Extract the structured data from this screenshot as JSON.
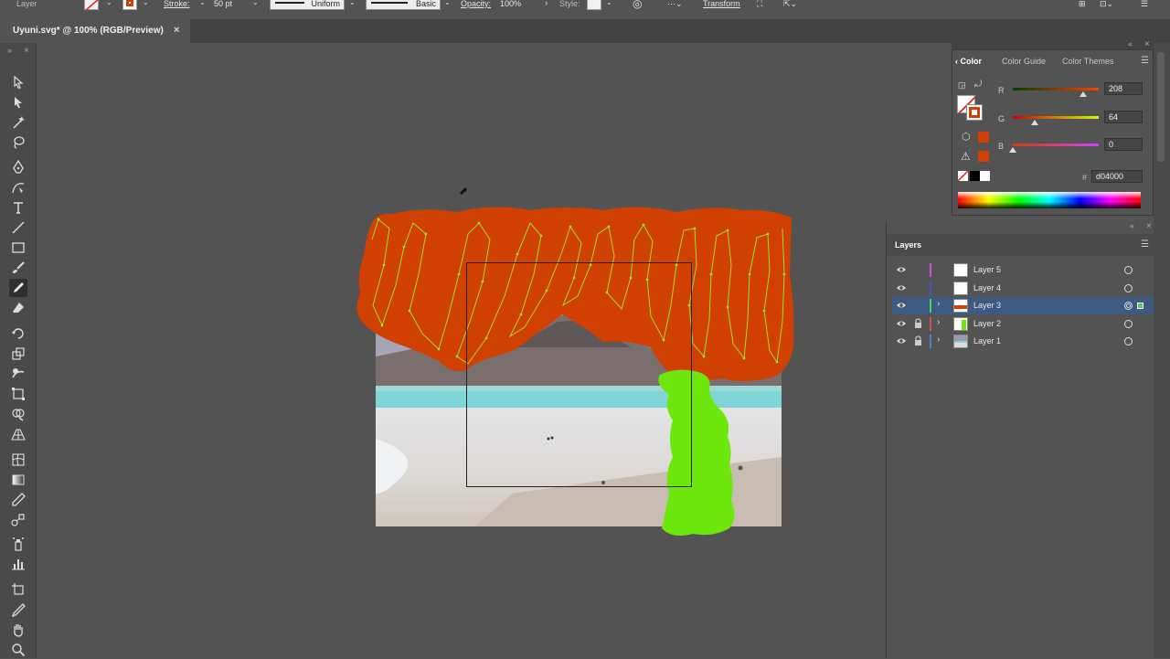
{
  "control_bar": {
    "layer_label": "Layer",
    "stroke_label": "Stroke:",
    "stroke_weight": "50 pt",
    "variable_width": "Uniform",
    "brush": "Basic",
    "opacity_label": "Opacity:",
    "opacity_value": "100%",
    "style_label": "Style:",
    "transform_label": "Transform"
  },
  "document": {
    "tab_title": "Uyuni.svg* @ 100% (RGB/Preview)",
    "close_glyph": "×"
  },
  "tools": [
    "selection-tool",
    "direct-selection-tool",
    "magic-wand-tool",
    "lasso-tool",
    "pen-tool",
    "curvature-tool",
    "type-tool",
    "line-tool",
    "rectangle-tool",
    "paintbrush-tool",
    "pencil-tool",
    "eraser-tool",
    "rotate-tool",
    "scale-tool",
    "warp-tool",
    "free-transform-tool",
    "shape-builder-tool",
    "perspective-grid-tool",
    "mesh-tool",
    "gradient-tool",
    "eyedropper-tool",
    "blend-tool",
    "symbol-sprayer-tool",
    "column-graph-tool",
    "artboard-tool",
    "slice-tool",
    "hand-tool",
    "zoom-tool"
  ],
  "color_panel": {
    "tabs": [
      "Color",
      "Color Guide",
      "Color Themes"
    ],
    "r_label": "R",
    "g_label": "G",
    "b_label": "B",
    "r_value": "208",
    "g_value": "64",
    "b_value": "0",
    "hash_label": "#",
    "hex_value": "d04000",
    "stroke_color": "#d04000",
    "r_level": 0.8157,
    "g_level": 0.251,
    "b_level": 0
  },
  "layers_panel": {
    "title": "Layers",
    "layers": [
      {
        "name": "Layer 5",
        "color": "#d14fd1",
        "locked": false,
        "expandable": false,
        "selected": false
      },
      {
        "name": "Layer 4",
        "color": "#4f4fd1",
        "locked": false,
        "expandable": false,
        "selected": false
      },
      {
        "name": "Layer 3",
        "color": "#4fd14f",
        "locked": false,
        "expandable": true,
        "selected": true
      },
      {
        "name": "Layer 2",
        "color": "#d14f4f",
        "locked": true,
        "expandable": true,
        "selected": false
      },
      {
        "name": "Layer 1",
        "color": "#4f7fd1",
        "locked": true,
        "expandable": true,
        "selected": false
      }
    ]
  },
  "colors": {
    "orange_shape": "#d04000",
    "green_shape": "#6ee80c",
    "path_outline": "#9edc2e",
    "selection_row": "#3d5a80"
  }
}
